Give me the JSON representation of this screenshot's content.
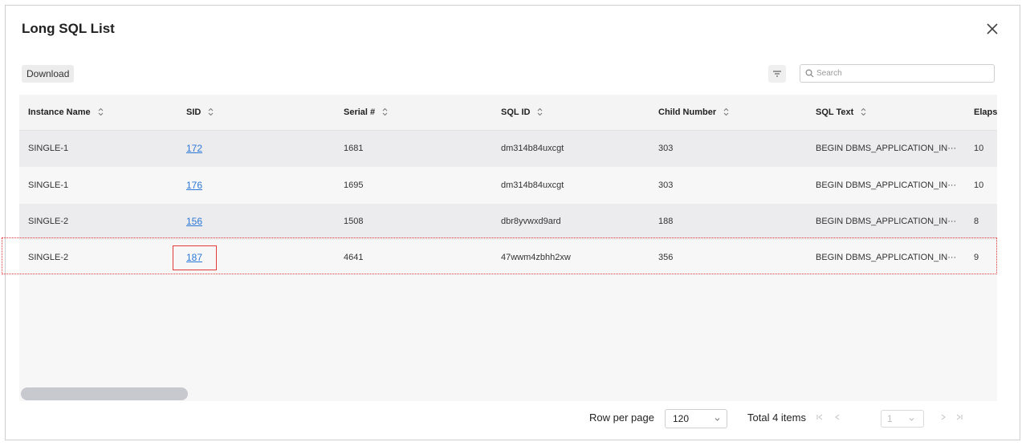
{
  "dialog": {
    "title": "Long SQL List",
    "download_label": "Download",
    "search_placeholder": "Search"
  },
  "table": {
    "columns": [
      "Instance Name",
      "SID",
      "Serial #",
      "SQL ID",
      "Child Number",
      "SQL Text",
      "Elaps"
    ],
    "rows": [
      {
        "instance": "SINGLE-1",
        "sid": "172",
        "serial": "1681",
        "sql_id": "dm314b84uxcgt",
        "child": "303",
        "sql_text": "BEGIN DBMS_APPLICATION_IN···",
        "elapsed": "10"
      },
      {
        "instance": "SINGLE-1",
        "sid": "176",
        "serial": "1695",
        "sql_id": "dm314b84uxcgt",
        "child": "303",
        "sql_text": "BEGIN DBMS_APPLICATION_IN···",
        "elapsed": "10"
      },
      {
        "instance": "SINGLE-2",
        "sid": "156",
        "serial": "1508",
        "sql_id": "dbr8yvwxd9ard",
        "child": "188",
        "sql_text": "BEGIN DBMS_APPLICATION_IN···",
        "elapsed": "8"
      },
      {
        "instance": "SINGLE-2",
        "sid": "187",
        "serial": "4641",
        "sql_id": "47wwm4zbhh2xw",
        "child": "356",
        "sql_text": "BEGIN DBMS_APPLICATION_IN···",
        "elapsed": "9"
      }
    ]
  },
  "pagination": {
    "row_per_page_label": "Row per page",
    "row_per_page_value": "120",
    "total_label": "Total 4 items",
    "current_page": "1"
  },
  "colors": {
    "link": "#2b78d6",
    "highlight": "#e03a3a"
  }
}
